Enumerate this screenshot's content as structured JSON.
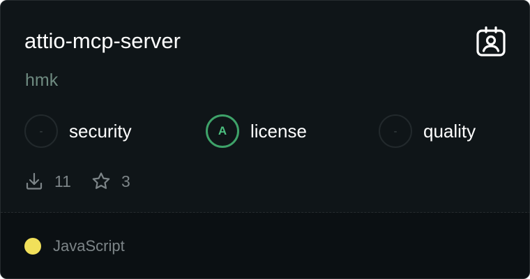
{
  "card": {
    "title": "attio-mcp-server",
    "author": "hmk",
    "badge_icon": "contact-card-icon",
    "scores": [
      {
        "grade": "-",
        "label": "security"
      },
      {
        "grade": "A",
        "label": "license"
      },
      {
        "grade": "-",
        "label": "quality"
      }
    ],
    "stats": {
      "downloads": "11",
      "stars": "3",
      "downloads_icon": "download-icon",
      "stars_icon": "star-icon"
    },
    "language": {
      "name": "JavaScript",
      "color": "#f1e05a"
    },
    "colors": {
      "background": "#0f1518",
      "footer_background": "#0b1013",
      "grade_a": "#3ea269",
      "author_text": "#6e8a80"
    }
  }
}
